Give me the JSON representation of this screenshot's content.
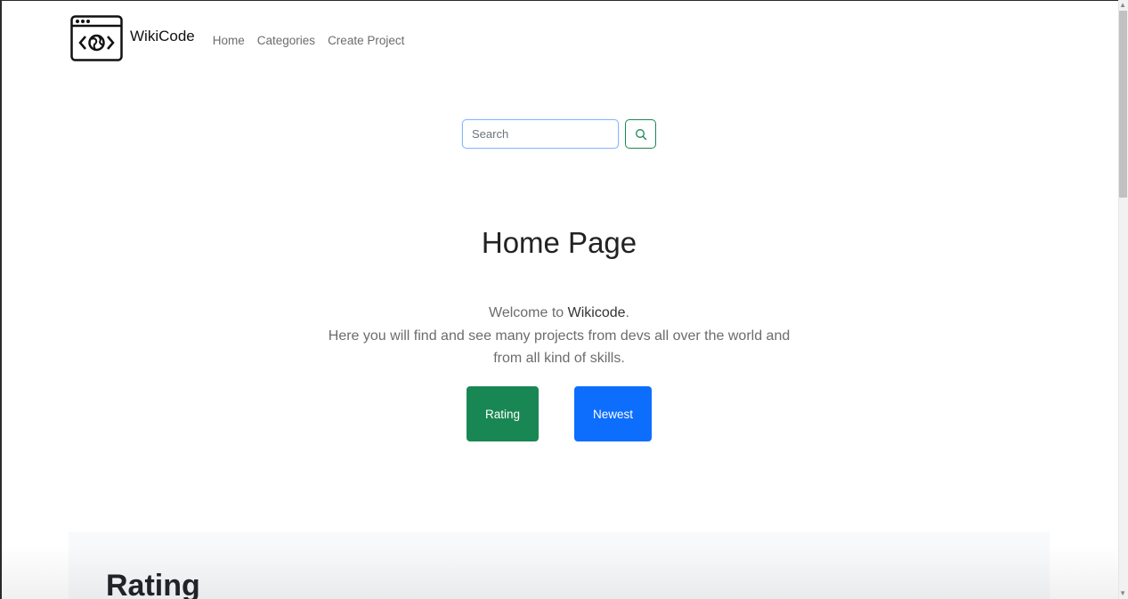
{
  "navbar": {
    "brand": "WikiCode",
    "links": [
      {
        "label": "Home"
      },
      {
        "label": "Categories"
      },
      {
        "label": "Create Project"
      }
    ]
  },
  "search": {
    "placeholder": "Search",
    "value": ""
  },
  "hero": {
    "title": "Home Page",
    "welcome_prefix": "Welcome to ",
    "welcome_name": "Wikicode",
    "welcome_suffix": ".",
    "description": "Here you will find and see many projects from devs all over the world and from all kind of skills.",
    "buttons": {
      "rating": "Rating",
      "newest": "Newest"
    }
  },
  "section": {
    "title": "Rating"
  },
  "colors": {
    "success": "#198754",
    "primary": "#0d6efd",
    "section_bg": "#f8f9fa"
  },
  "icons": {
    "logo": "browser-globe-code-icon",
    "search": "search-icon"
  }
}
